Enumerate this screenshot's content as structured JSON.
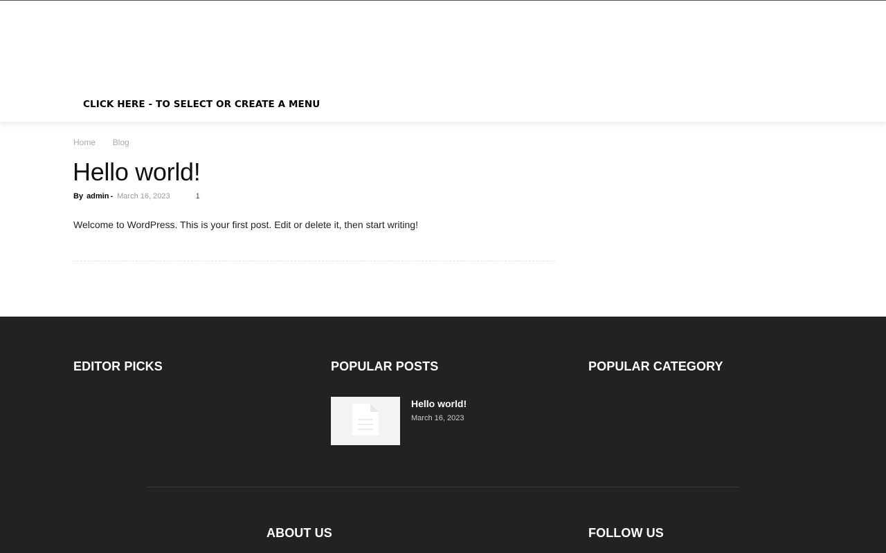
{
  "header": {
    "menu_link": "CLICK HERE - TO SELECT OR CREATE A MENU"
  },
  "breadcrumb": {
    "items": [
      "Home",
      "Blog"
    ]
  },
  "post": {
    "title": "Hello world!",
    "by_label": "By",
    "author": "admin",
    "dash": "-",
    "date": "March 16, 2023",
    "comment_count": "1",
    "body": "Welcome to WordPress. This is your first post. Edit or delete it, then start writing!"
  },
  "footer": {
    "editor_picks_heading": "EDITOR PICKS",
    "popular_posts_heading": "POPULAR POSTS",
    "popular_category_heading": "POPULAR CATEGORY",
    "popular_posts": [
      {
        "title": "Hello world!",
        "date": "March 16, 2023"
      }
    ],
    "about_us_heading": "ABOUT US",
    "follow_us_heading": "FOLLOW US"
  },
  "colors": {
    "footer_bg": "#222222",
    "text_dark": "#111111",
    "muted": "#999999"
  },
  "icons": {
    "comment": "comment-bubble-icon",
    "thumbnail_placeholder": "document-icon"
  }
}
